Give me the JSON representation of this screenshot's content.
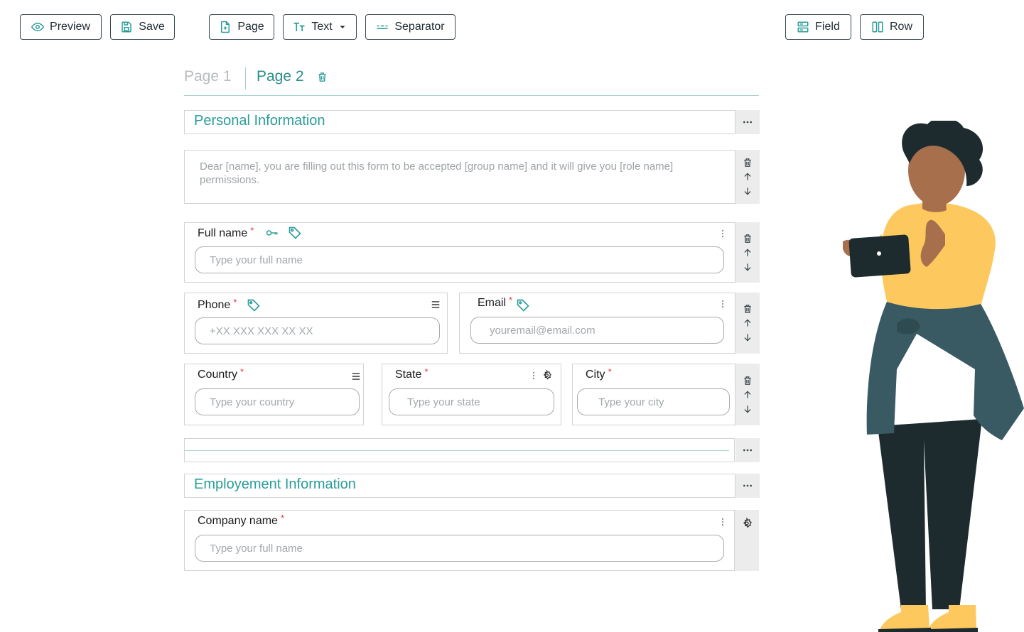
{
  "toolbar": {
    "preview_label": "Preview",
    "save_label": "Save",
    "page_label": "Page",
    "text_label": "Text",
    "separator_label": "Separator",
    "field_label": "Field",
    "row_label": "Row"
  },
  "tabs": {
    "page1": "Page 1",
    "page2": "Page 2"
  },
  "sections": {
    "personal": "Personal Information",
    "employment": "Employement Information"
  },
  "intro_text": "Dear [name], you are filling out this form to be accepted [group name] and it will give you [role name] permissions.",
  "fields": {
    "full_name": {
      "label": "Full name",
      "required": "*",
      "placeholder": "Type your full name"
    },
    "phone": {
      "label": "Phone",
      "required": "*",
      "placeholder": "+XX XXX XXX XX XX"
    },
    "email": {
      "label": "Email",
      "required": "*",
      "placeholder": "youremail@email.com"
    },
    "country": {
      "label": "Country",
      "required": "*",
      "placeholder": "Type your country"
    },
    "state": {
      "label": "State",
      "required": "*",
      "placeholder": "Type your state"
    },
    "city": {
      "label": "City",
      "required": "*",
      "placeholder": "Type your city"
    },
    "company": {
      "label": "Company name",
      "required": "*",
      "placeholder": "Type your full name"
    }
  },
  "colors": {
    "accent": "#2a9d98",
    "required": "#e2344a",
    "illustration_shirt": "#fdc95f",
    "illustration_jacket": "#3a5a63",
    "illustration_dark": "#1e2b2e"
  },
  "icons": [
    "eye-icon",
    "save-icon",
    "page-add-icon",
    "text-icon",
    "separator-icon",
    "field-icon",
    "row-icon",
    "trash-icon",
    "arrow-up-icon",
    "arrow-down-icon",
    "more-icon",
    "key-icon",
    "tag-icon",
    "menu-icon",
    "gear-icon"
  ]
}
